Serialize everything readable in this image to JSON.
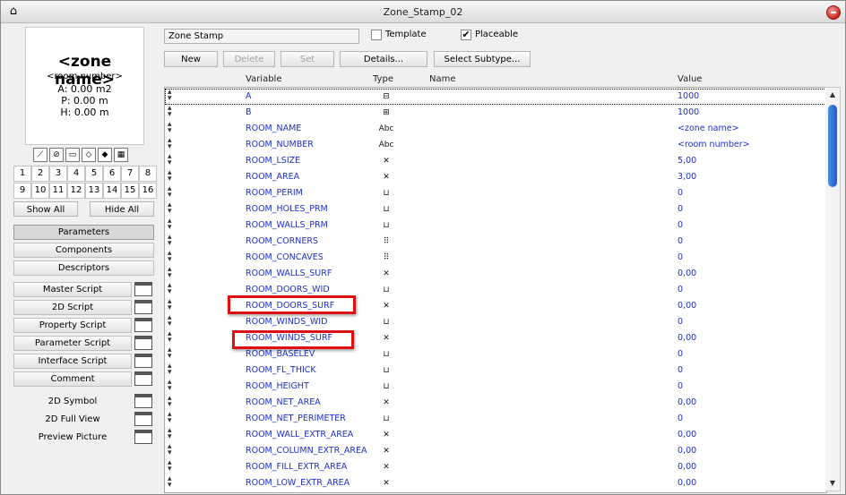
{
  "window": {
    "title": "Zone_Stamp_02",
    "app_icon": "archicad-icon",
    "close_color": "#d0302a"
  },
  "preview": {
    "zone_name": "<zone name>",
    "room_number": "<room number>",
    "lines": [
      "A: 0.00 m2",
      "P: 0.00 m",
      "H: 0.00 m"
    ]
  },
  "view_icons": [
    "2d-view-icon",
    "3d-box-icon",
    "plan-icon",
    "3d-cube-icon",
    "shaded-cube-icon",
    "film-icon"
  ],
  "number_buttons": [
    "1",
    "2",
    "3",
    "4",
    "5",
    "6",
    "7",
    "8",
    "9",
    "10",
    "11",
    "12",
    "13",
    "14",
    "15",
    "16"
  ],
  "left_buttons": {
    "show_all": "Show All",
    "hide_all": "Hide All"
  },
  "tabs": [
    "Parameters",
    "Components",
    "Descriptors"
  ],
  "scripts": [
    "Master Script",
    "2D Script",
    "Property Script",
    "Parameter Script",
    "Interface Script",
    "Comment"
  ],
  "views": [
    "2D Symbol",
    "2D Full View",
    "Preview Picture"
  ],
  "top": {
    "stamp_name": "Zone Stamp",
    "template_label": "Template",
    "template_checked": false,
    "placeable_label": "Placeable",
    "placeable_checked": true,
    "check_mark": "✔"
  },
  "toolbar": {
    "new": "New",
    "delete": "Delete",
    "set": "Set",
    "details": "Details...",
    "select_subtype": "Select Subtype..."
  },
  "table": {
    "headers": {
      "variable": "Variable",
      "type": "Type",
      "name": "Name",
      "value": "Value"
    },
    "rows": [
      {
        "variable": "A",
        "type": "length-x-icon",
        "value": "1000"
      },
      {
        "variable": "B",
        "type": "length-y-icon",
        "value": "1000"
      },
      {
        "variable": "ROOM_NAME",
        "type": "Abc",
        "value": "<zone name>"
      },
      {
        "variable": "ROOM_NUMBER",
        "type": "Abc",
        "value": "<room number>"
      },
      {
        "variable": "ROOM_LSIZE",
        "type": "real-icon",
        "value": "5,00"
      },
      {
        "variable": "ROOM_AREA",
        "type": "real-icon",
        "value": "3,00"
      },
      {
        "variable": "ROOM_PERIM",
        "type": "length-icon",
        "value": "0"
      },
      {
        "variable": "ROOM_HOLES_PRM",
        "type": "length-icon",
        "value": "0"
      },
      {
        "variable": "ROOM_WALLS_PRM",
        "type": "length-icon",
        "value": "0"
      },
      {
        "variable": "ROOM_CORNERS",
        "type": "integer-icon",
        "value": "0"
      },
      {
        "variable": "ROOM_CONCAVES",
        "type": "integer-icon",
        "value": "0"
      },
      {
        "variable": "ROOM_WALLS_SURF",
        "type": "real-icon",
        "value": "0,00"
      },
      {
        "variable": "ROOM_DOORS_WID",
        "type": "length-icon",
        "value": "0"
      },
      {
        "variable": "ROOM_DOORS_SURF",
        "type": "real-icon",
        "value": "0,00"
      },
      {
        "variable": "ROOM_WINDS_WID",
        "type": "length-icon",
        "value": "0"
      },
      {
        "variable": "ROOM_WINDS_SURF",
        "type": "real-icon",
        "value": "0,00"
      },
      {
        "variable": "ROOM_BASELEV",
        "type": "length-icon",
        "value": "0"
      },
      {
        "variable": "ROOM_FL_THICK",
        "type": "length-icon",
        "value": "0"
      },
      {
        "variable": "ROOM_HEIGHT",
        "type": "length-icon",
        "value": "0"
      },
      {
        "variable": "ROOM_NET_AREA",
        "type": "real-icon",
        "value": "0,00"
      },
      {
        "variable": "ROOM_NET_PERIMETER",
        "type": "length-icon",
        "value": "0"
      },
      {
        "variable": "ROOM_WALL_EXTR_AREA",
        "type": "real-icon",
        "value": "0,00"
      },
      {
        "variable": "ROOM_COLUMN_EXTR_AREA",
        "type": "real-icon",
        "value": "0,00"
      },
      {
        "variable": "ROOM_FILL_EXTR_AREA",
        "type": "real-icon",
        "value": "0,00"
      },
      {
        "variable": "ROOM_LOW_EXTR_AREA",
        "type": "real-icon",
        "value": "0,00"
      }
    ]
  },
  "highlight_color": "#e01010"
}
